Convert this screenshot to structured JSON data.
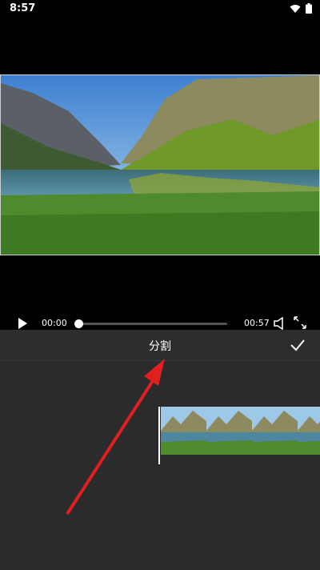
{
  "status_bar": {
    "time": "8:57"
  },
  "player": {
    "current_time": "00:00",
    "total_time": "00:57",
    "progress": 0.0
  },
  "toolbar": {
    "title": "分割"
  },
  "timeline": {
    "thumbnail_count": 4
  },
  "colors": {
    "accent_arrow": "#e02020",
    "background": "#2b2b2b"
  }
}
